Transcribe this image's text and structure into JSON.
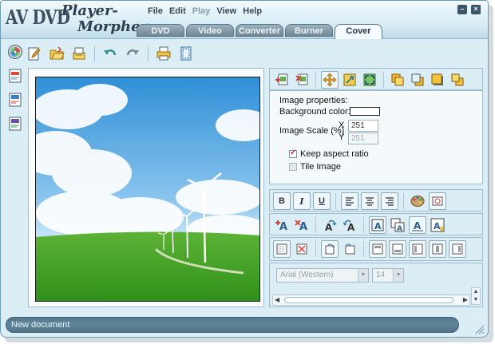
{
  "app": {
    "logo_line1": "AV DVD",
    "logo_line2": "Player-",
    "logo_line3": "Morpher"
  },
  "menu": [
    {
      "label": "File",
      "enabled": true
    },
    {
      "label": "Edit",
      "enabled": true
    },
    {
      "label": "Play",
      "enabled": false
    },
    {
      "label": "View",
      "enabled": true
    },
    {
      "label": "Help",
      "enabled": true
    }
  ],
  "tabs": [
    {
      "label": "DVD",
      "active": false
    },
    {
      "label": "Video",
      "active": false
    },
    {
      "label": "Converter",
      "active": false
    },
    {
      "label": "Burner",
      "active": false
    },
    {
      "label": "Cover",
      "active": true
    }
  ],
  "window_buttons": {
    "minimize": "–",
    "close": "×"
  },
  "toolbar_icons": [
    "new-cover-icon",
    "open-folder-icon",
    "save-icon",
    "undo-icon",
    "redo-icon",
    "print-icon",
    "page-frame-icon"
  ],
  "left_icons": [
    "disc-icon",
    "dvd-cover-icon",
    "cd-cover-icon",
    "dvd-label-icon"
  ],
  "image_properties": {
    "heading": "Image properties:",
    "background_color_label": "Background color:",
    "background_color": "#ffffff",
    "scale_label": "Image Scale (%)",
    "x_label": "X",
    "y_label": "Y",
    "scale_x": "251",
    "scale_y": "251",
    "keep_aspect_label": "Keep aspect ratio",
    "keep_aspect_checked": true,
    "tile_label": "Tile Image",
    "tile_checked": false
  },
  "font": {
    "family": "Arial (Western)",
    "size": "14"
  },
  "status": {
    "text": "New document"
  },
  "colors": {
    "accent": "#3b5668",
    "panel": "#dbeef6",
    "status_bar": "#5f8599"
  }
}
